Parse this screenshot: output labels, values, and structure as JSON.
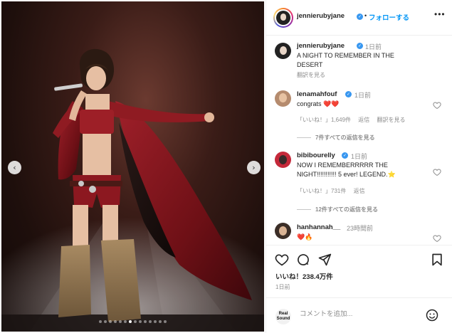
{
  "post": {
    "username": "jennierubyjane",
    "follow_label": "フォローする",
    "separator": "•",
    "more_label": "•••"
  },
  "caption": {
    "username": "jennierubyjane",
    "time": "1日前",
    "text_line1": "A NIGHT TO REMEMBER IN THE",
    "text_line2": "DESERT",
    "translate_label": "翻訳を見る"
  },
  "comments": [
    {
      "username": "lenamahfouf",
      "time": "1日前",
      "text": "congrats ❤️❤️",
      "likes": "「いいね！」1,649件",
      "reply_label": "返信",
      "translate_label": "翻訳を見る",
      "view_replies": "7件すべての返信を見る"
    },
    {
      "username": "bibibourelly",
      "time": "1日前",
      "text_line1": "NOW I REMEMBERRRRR THE",
      "text_line2": "NIGHT!!!!!!!!!!! 5 ever! LEGEND.⭐",
      "likes": "「いいね！」731件",
      "reply_label": "返信",
      "view_replies": "12件すべての返信を見る"
    },
    {
      "username": "hanhannah__",
      "time": "23時間前",
      "text": "❤️🔥"
    }
  ],
  "actions": {
    "likes": "いいね！238.4万件",
    "date": "1日前"
  },
  "comment_box": {
    "placeholder": "コメントを追加...",
    "logo_text": "Real Sound"
  },
  "carousel": {
    "total": 14,
    "active_index": 6
  },
  "colors": {
    "accent": "#0095f6",
    "verified": "#3897f0",
    "text": "#262626",
    "muted": "#8e8e8e",
    "coat": "#8b1a1f"
  },
  "icons": {
    "like": "heart-icon",
    "comment": "comment-icon",
    "share": "paper-plane-icon",
    "save": "bookmark-icon",
    "emoji": "smiley-icon",
    "prev": "chevron-left-icon",
    "next": "chevron-right-icon"
  }
}
